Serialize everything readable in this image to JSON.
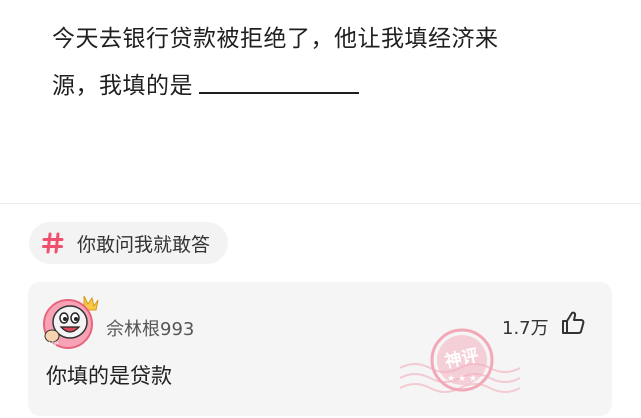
{
  "post": {
    "line1": "今天去银行贷款被拒绝了，他让我填经济来",
    "line2": "源，我填的是"
  },
  "topic": {
    "label": "你敢问我就敢答",
    "icon": "hash-icon",
    "color": "#f0506e"
  },
  "comment": {
    "username": "佘林根993",
    "likes": "1.7万",
    "text": "你填的是贷款",
    "badge_text": "神评",
    "avatar_icon": "cartoon-avatar",
    "like_icon": "thumbs-up-icon"
  }
}
